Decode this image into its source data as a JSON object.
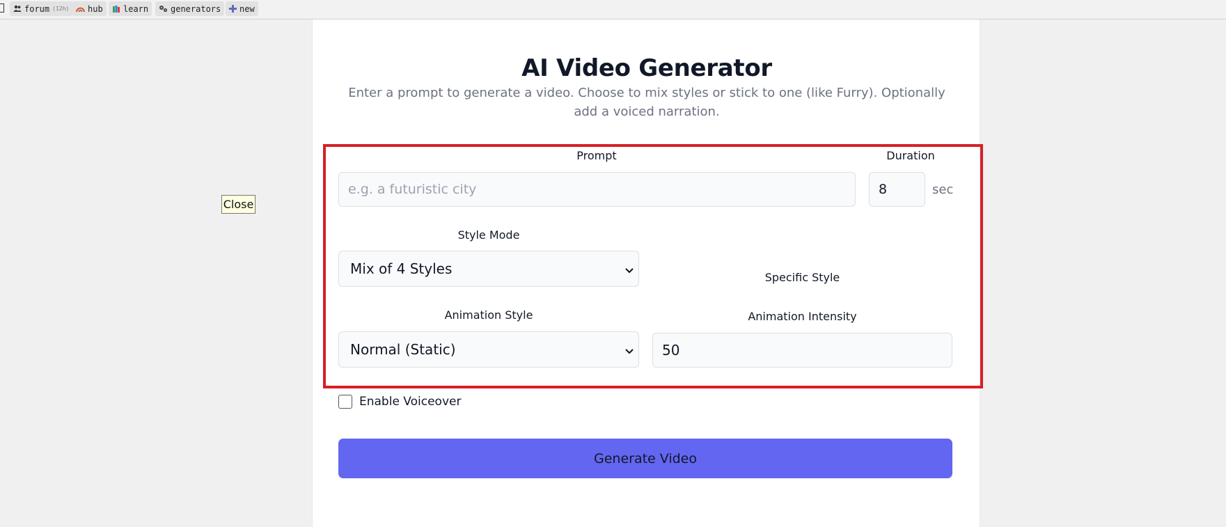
{
  "nav": {
    "items": [
      {
        "label": "forum",
        "count": "(12h)",
        "icon": "people-icon"
      },
      {
        "label": "hub",
        "icon": "rainbow-icon"
      },
      {
        "label": "learn",
        "icon": "books-icon"
      },
      {
        "label": "generators",
        "icon": "gears-icon"
      },
      {
        "label": "new",
        "icon": "plus-icon"
      }
    ]
  },
  "tooltip": {
    "close_label": "Close"
  },
  "header": {
    "title": "AI Video Generator",
    "subtitle": "Enter a prompt to generate a video. Choose to mix styles or stick to one (like Furry). Optionally add a voiced narration."
  },
  "form": {
    "prompt": {
      "label": "Prompt",
      "placeholder": "e.g. a futuristic city"
    },
    "duration": {
      "label": "Duration",
      "value": "8",
      "unit": "sec"
    },
    "style_mode": {
      "label": "Style Mode",
      "selected": "Mix of 4 Styles"
    },
    "specific_style": {
      "label": "Specific Style"
    },
    "animation_style": {
      "label": "Animation Style",
      "selected": "Normal (Static)"
    },
    "animation_intensity": {
      "label": "Animation Intensity",
      "value": "50"
    },
    "voiceover": {
      "label": "Enable Voiceover",
      "checked": false
    },
    "submit_label": "Generate Video"
  },
  "colors": {
    "accent": "#6366f1",
    "highlight": "#d81f26",
    "title": "#111827",
    "muted": "#6b7280"
  }
}
